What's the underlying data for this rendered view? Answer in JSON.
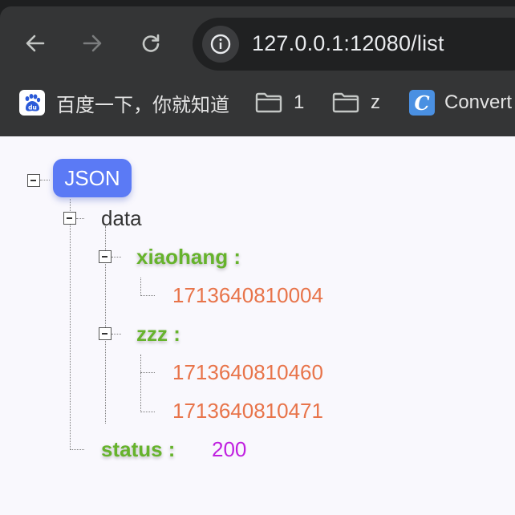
{
  "browser": {
    "url": "127.0.0.1:12080/list",
    "bookmarks": [
      {
        "label": "百度一下，你就知道",
        "icon": "baidu-icon"
      },
      {
        "label": "1",
        "icon": "folder-icon"
      },
      {
        "label": "z",
        "icon": "folder-icon"
      },
      {
        "label": "Convert",
        "icon": "convert-icon"
      }
    ]
  },
  "tree": {
    "root_label": "JSON",
    "data_key": "data",
    "xiaohang_key": "xiaohang :",
    "xiaohang_values": [
      "1713640810004"
    ],
    "zzz_key": "zzz :",
    "zzz_values": [
      "1713640810460",
      "1713640810471"
    ],
    "status_key": "status :",
    "status_value": "200"
  },
  "colors": {
    "root_badge": "#5b7af5",
    "key_green": "#66b32c",
    "number_orange": "#e8744a",
    "status_purple": "#c020e0"
  }
}
